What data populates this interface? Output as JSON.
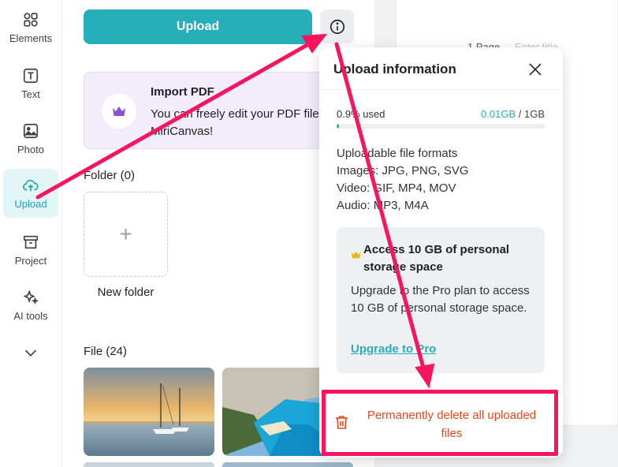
{
  "sidebar": {
    "items": [
      {
        "label": "Elements",
        "icon": "elements-icon"
      },
      {
        "label": "Text",
        "icon": "text-icon"
      },
      {
        "label": "Photo",
        "icon": "photo-icon"
      },
      {
        "label": "Upload",
        "icon": "cloud-upload-icon",
        "active": true
      },
      {
        "label": "Project",
        "icon": "archive-icon"
      },
      {
        "label": "AI tools",
        "icon": "sparkle-icon"
      }
    ],
    "more_icon": "chevron-down-icon"
  },
  "panel": {
    "upload_label": "Upload",
    "info_icon": "info-icon",
    "import_card": {
      "title": "Import PDF",
      "desc": "You can freely edit your PDF files in MiriCanvas!"
    },
    "folder_section": "Folder (0)",
    "new_folder_label": "New folder",
    "file_section": "File (24)"
  },
  "canvas": {
    "page_label": "1 Page",
    "title_placeholder": "Enter title"
  },
  "popover": {
    "title": "Upload information",
    "usage_percent_text": "0.9% used",
    "usage_used": "0.01GB",
    "usage_sep": " / ",
    "usage_total": "1GB",
    "usage_fraction": 0.009,
    "formats_heading": "Uploadable file formats",
    "formats_images": "Images: JPG, PNG, SVG",
    "formats_video": "Video: GIF, MP4, MOV",
    "formats_audio": "Audio: MP3, M4A",
    "pro_title": "Access 10 GB of personal storage space",
    "pro_desc": "Upgrade to the Pro plan to access 10 GB of personal storage space.",
    "pro_link": "Upgrade to Pro",
    "delete_label": "Permanently delete all uploaded files"
  },
  "colors": {
    "accent": "#27aebb",
    "danger": "#e8461d",
    "annotation": "#f8145f"
  }
}
